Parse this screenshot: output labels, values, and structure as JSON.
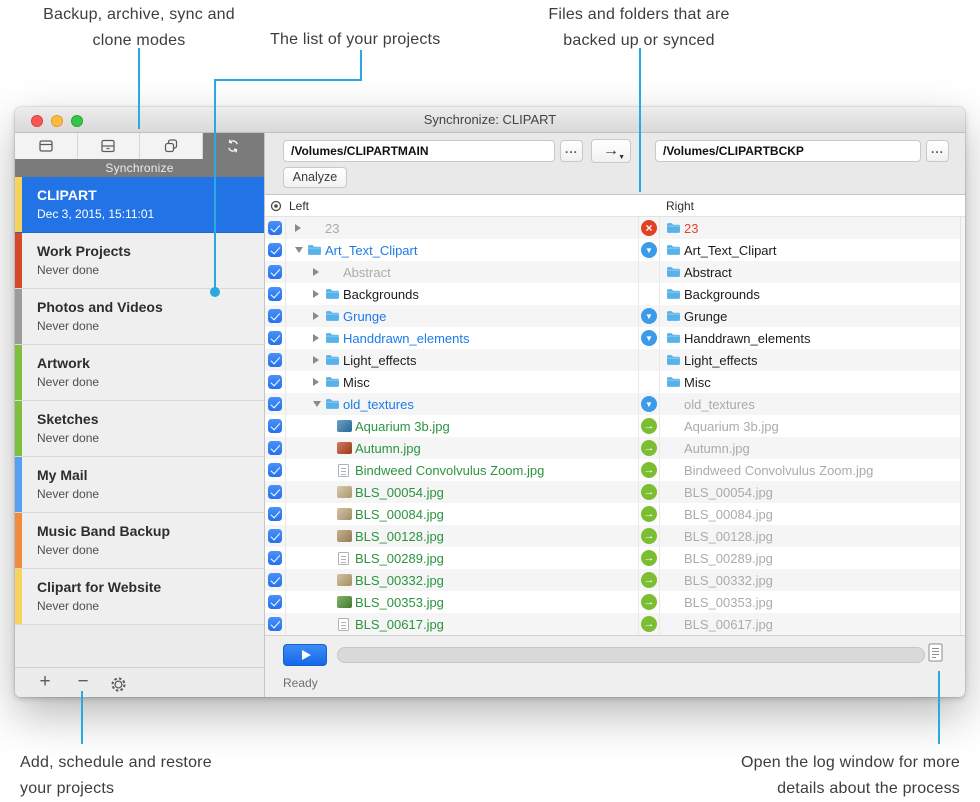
{
  "annotations": {
    "modes": {
      "line1": "Backup, archive, sync and",
      "line2": "clone modes"
    },
    "project_list": {
      "line1": "The list of your projects"
    },
    "files": {
      "line1": "Files and folders that are",
      "line2": "backed up or synced"
    },
    "add": {
      "line1": "Add, schedule and restore",
      "line2": "your projects"
    },
    "log": {
      "line1": "Open the log window for more",
      "line2": "details about the process"
    }
  },
  "colors": {
    "annotation_accent": "#29a9e0",
    "selection_blue": "#2273e6",
    "status_delete": "#e44025",
    "status_update": "#3b9be9",
    "status_copy": "#7cbe31"
  },
  "window": {
    "title": "Synchronize: CLIPART",
    "toolbar": {
      "mode_label": "Synchronize"
    },
    "controls": {
      "source_path": "/Volumes/CLIPARTMAIN",
      "dest_path": "/Volumes/CLIPARTBCKP",
      "browse_label": "...",
      "direction_label": "→",
      "analyze_label": "Analyze"
    },
    "columns": {
      "left": "Left",
      "right": "Right"
    },
    "projects": [
      {
        "name": "CLIPART",
        "status": "Dec 3, 2015, 15:11:01",
        "color": "#f5d35c",
        "selected": true
      },
      {
        "name": "Work Projects",
        "status": "Never done",
        "color": "#d44a2a",
        "selected": false
      },
      {
        "name": "Photos and Videos",
        "status": "Never done",
        "color": "#9b9b9b",
        "selected": false
      },
      {
        "name": "Artwork",
        "status": "Never done",
        "color": "#7fbf3f",
        "selected": false
      },
      {
        "name": "Sketches",
        "status": "Never done",
        "color": "#7fbf3f",
        "selected": false
      },
      {
        "name": "My Mail",
        "status": "Never done",
        "color": "#55a0f2",
        "selected": false
      },
      {
        "name": "Music Band Backup",
        "status": "Never done",
        "color": "#f08a3c",
        "selected": false
      },
      {
        "name": "Clipart for Website",
        "status": "Never done",
        "color": "#f5d35c",
        "selected": false
      }
    ],
    "rows": [
      {
        "name": "23",
        "lvl": 0,
        "disc": "right",
        "licon": null,
        "lcolor": "gray",
        "status": "delete",
        "ricon": "folder",
        "rcolor": "red",
        "checked": true
      },
      {
        "name": "Art_Text_Clipart",
        "lvl": 0,
        "disc": "down",
        "licon": "folder",
        "lcolor": "blue",
        "status": "update",
        "ricon": "folder",
        "rcolor": "black",
        "checked": true
      },
      {
        "name": "Abstract",
        "lvl": 1,
        "disc": "right",
        "licon": null,
        "lcolor": "gray",
        "status": null,
        "ricon": "folder",
        "rcolor": "black",
        "checked": true
      },
      {
        "name": "Backgrounds",
        "lvl": 1,
        "disc": "right",
        "licon": "folder",
        "lcolor": "black",
        "status": null,
        "ricon": "folder",
        "rcolor": "black",
        "checked": true
      },
      {
        "name": "Grunge",
        "lvl": 1,
        "disc": "right",
        "licon": "folder",
        "lcolor": "blue",
        "status": "update",
        "ricon": "folder",
        "rcolor": "black",
        "checked": true
      },
      {
        "name": "Handdrawn_elements",
        "lvl": 1,
        "disc": "right",
        "licon": "folder",
        "lcolor": "blue",
        "status": "update",
        "ricon": "folder",
        "rcolor": "black",
        "checked": true
      },
      {
        "name": "Light_effects",
        "lvl": 1,
        "disc": "right",
        "licon": "folder",
        "lcolor": "black",
        "status": null,
        "ricon": "folder",
        "rcolor": "black",
        "checked": true
      },
      {
        "name": "Misc",
        "lvl": 1,
        "disc": "right",
        "licon": "folder",
        "lcolor": "black",
        "status": null,
        "ricon": "folder",
        "rcolor": "black",
        "checked": true
      },
      {
        "name": "old_textures",
        "lvl": 1,
        "disc": "down",
        "licon": "folder",
        "lcolor": "blue",
        "status": "update",
        "ricon": null,
        "rcolor": "gray",
        "checked": true
      },
      {
        "name": "Aquarium 3b.jpg",
        "lvl": 2,
        "disc": null,
        "licon": "thumb",
        "thumbcolor": "#2e79b0",
        "lcolor": "green",
        "status": "copy",
        "ricon": null,
        "rcolor": "gray",
        "checked": true
      },
      {
        "name": "Autumn.jpg",
        "lvl": 2,
        "disc": null,
        "licon": "thumb",
        "thumbcolor": "#b8431f",
        "lcolor": "green",
        "status": "copy",
        "ricon": null,
        "rcolor": "gray",
        "checked": true
      },
      {
        "name": "Bindweed Convolvulus Zoom.jpg",
        "lvl": 2,
        "disc": null,
        "licon": "doc",
        "thumbcolor": null,
        "lcolor": "green",
        "status": "copy",
        "ricon": null,
        "rcolor": "gray",
        "checked": true
      },
      {
        "name": "BLS_00054.jpg",
        "lvl": 2,
        "disc": null,
        "licon": "thumb",
        "thumbcolor": "#c9b285",
        "lcolor": "green",
        "status": "copy",
        "ricon": null,
        "rcolor": "gray",
        "checked": true
      },
      {
        "name": "BLS_00084.jpg",
        "lvl": 2,
        "disc": null,
        "licon": "thumb",
        "thumbcolor": "#c3a87c",
        "lcolor": "green",
        "status": "copy",
        "ricon": null,
        "rcolor": "gray",
        "checked": true
      },
      {
        "name": "BLS_00128.jpg",
        "lvl": 2,
        "disc": null,
        "licon": "thumb",
        "thumbcolor": "#ae9063",
        "lcolor": "green",
        "status": "copy",
        "ricon": null,
        "rcolor": "gray",
        "checked": true
      },
      {
        "name": "BLS_00289.jpg",
        "lvl": 2,
        "disc": null,
        "licon": "doc",
        "thumbcolor": null,
        "lcolor": "green",
        "status": "copy",
        "ricon": null,
        "rcolor": "gray",
        "checked": true
      },
      {
        "name": "BLS_00332.jpg",
        "lvl": 2,
        "disc": null,
        "licon": "thumb",
        "thumbcolor": "#c0a676",
        "lcolor": "green",
        "status": "copy",
        "ricon": null,
        "rcolor": "gray",
        "checked": true
      },
      {
        "name": "BLS_00353.jpg",
        "lvl": 2,
        "disc": null,
        "licon": "thumb",
        "thumbcolor": "#4f8f33",
        "lcolor": "green",
        "status": "copy",
        "ricon": null,
        "rcolor": "gray",
        "checked": true
      },
      {
        "name": "BLS_00617.jpg",
        "lvl": 2,
        "disc": null,
        "licon": "doc",
        "thumbcolor": null,
        "lcolor": "green",
        "status": "copy",
        "ricon": null,
        "rcolor": "gray",
        "checked": true
      }
    ],
    "footer": {
      "status": "Ready"
    }
  }
}
